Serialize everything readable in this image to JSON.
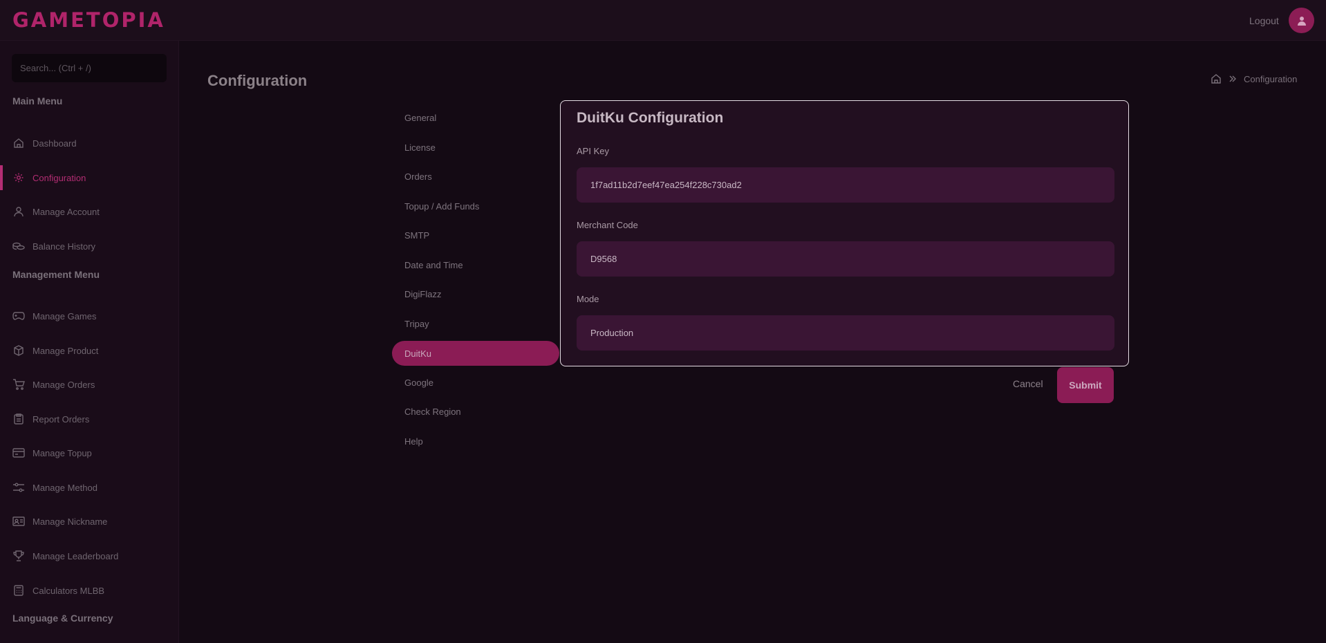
{
  "header": {
    "logo": "GAMETOPIA",
    "logout_label": "Logout",
    "avatar_icon": "user-icon"
  },
  "sidebar": {
    "search_placeholder": "Search... (Ctrl + /)",
    "main_menu_title": "Main Menu",
    "main_items": [
      {
        "label": "Dashboard",
        "icon": "home-icon"
      },
      {
        "label": "Configuration",
        "icon": "gear-icon",
        "active": true
      },
      {
        "label": "Manage Account",
        "icon": "user-icon"
      },
      {
        "label": "Balance History",
        "icon": "coins-icon"
      }
    ],
    "management_menu_title": "Management Menu",
    "management_items": [
      {
        "label": "Manage Games",
        "icon": "gamepad-icon"
      },
      {
        "label": "Manage Product",
        "icon": "box-icon"
      },
      {
        "label": "Manage Orders",
        "icon": "cart-icon"
      },
      {
        "label": "Report Orders",
        "icon": "clipboard-icon"
      },
      {
        "label": "Manage Topup",
        "icon": "card-icon"
      },
      {
        "label": "Manage Method",
        "icon": "sliders-icon"
      },
      {
        "label": "Manage Nickname",
        "icon": "id-card-icon"
      },
      {
        "label": "Manage Leaderboard",
        "icon": "trophy-icon"
      },
      {
        "label": "Calculators MLBB",
        "icon": "calculator-icon"
      }
    ],
    "language_title": "Language & Currency"
  },
  "page": {
    "title": "Configuration",
    "breadcrumb_current": "Configuration"
  },
  "config_menu": [
    {
      "label": "General"
    },
    {
      "label": "License"
    },
    {
      "label": "Orders"
    },
    {
      "label": "Topup / Add Funds"
    },
    {
      "label": "SMTP"
    },
    {
      "label": "Date and Time"
    },
    {
      "label": "DigiFlazz"
    },
    {
      "label": "Tripay"
    },
    {
      "label": "DuitKu",
      "active": true
    },
    {
      "label": "Google"
    },
    {
      "label": "Check Region"
    },
    {
      "label": "Help"
    }
  ],
  "panel": {
    "title": "DuitKu Configuration",
    "fields": [
      {
        "label": "API Key",
        "value": "1f7ad11b2d7eef47ea254f228c730ad2"
      },
      {
        "label": "Merchant Code",
        "value": "D9568"
      },
      {
        "label": "Mode",
        "value": "Production"
      }
    ],
    "cancel_label": "Cancel",
    "submit_label": "Submit"
  },
  "colors": {
    "accent": "#8b1c55",
    "background": "#140a14",
    "sidebar": "#1a0c19"
  }
}
